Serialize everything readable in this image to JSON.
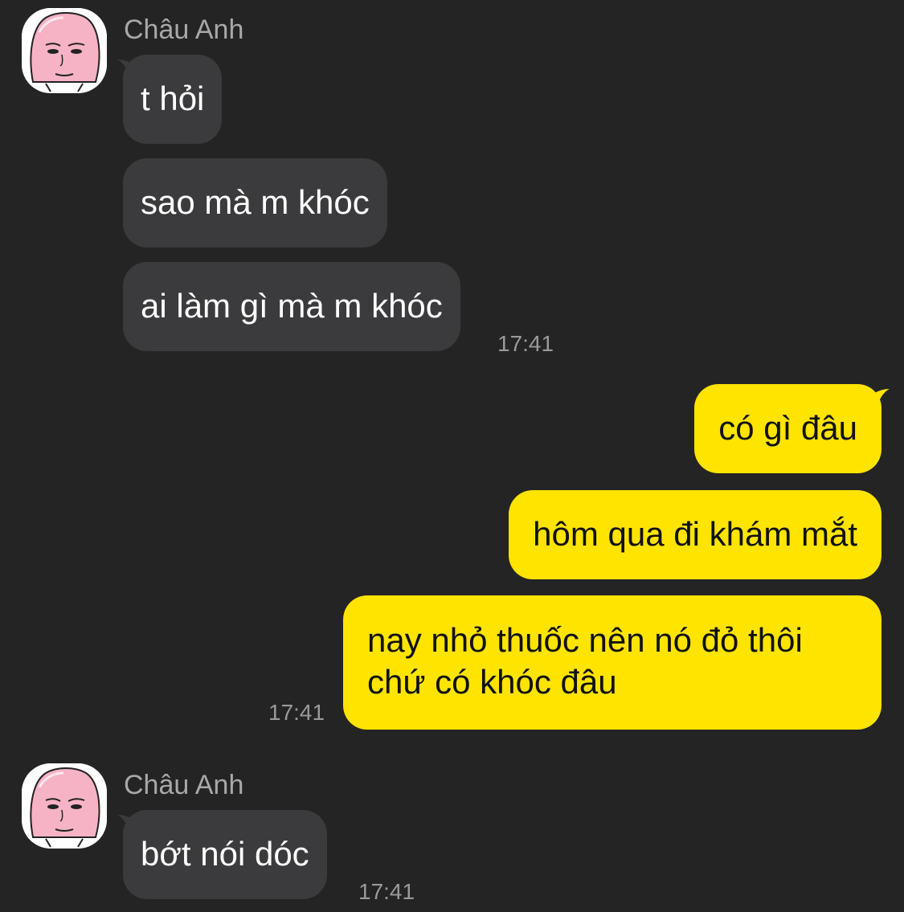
{
  "chat": {
    "background": "#242424",
    "incoming_bubble_color": "#3b3b3d",
    "outgoing_bubble_color": "#ffe400",
    "groups": [
      {
        "direction": "incoming",
        "sender": "Châu Anh",
        "avatar_icon": "bald-face-sticker-avatar",
        "messages": [
          "t hỏi",
          "sao mà m khóc",
          "ai làm gì mà m khóc"
        ],
        "time": "17:41"
      },
      {
        "direction": "outgoing",
        "messages": [
          "có gì đâu",
          "hôm qua đi khám mắt",
          "nay nhỏ thuốc nên nó đỏ thôi chứ có khóc đâu"
        ],
        "time": "17:41"
      },
      {
        "direction": "incoming",
        "sender": "Châu Anh",
        "avatar_icon": "bald-face-sticker-avatar",
        "messages": [
          "bớt nói dóc"
        ],
        "time": "17:41"
      }
    ]
  }
}
